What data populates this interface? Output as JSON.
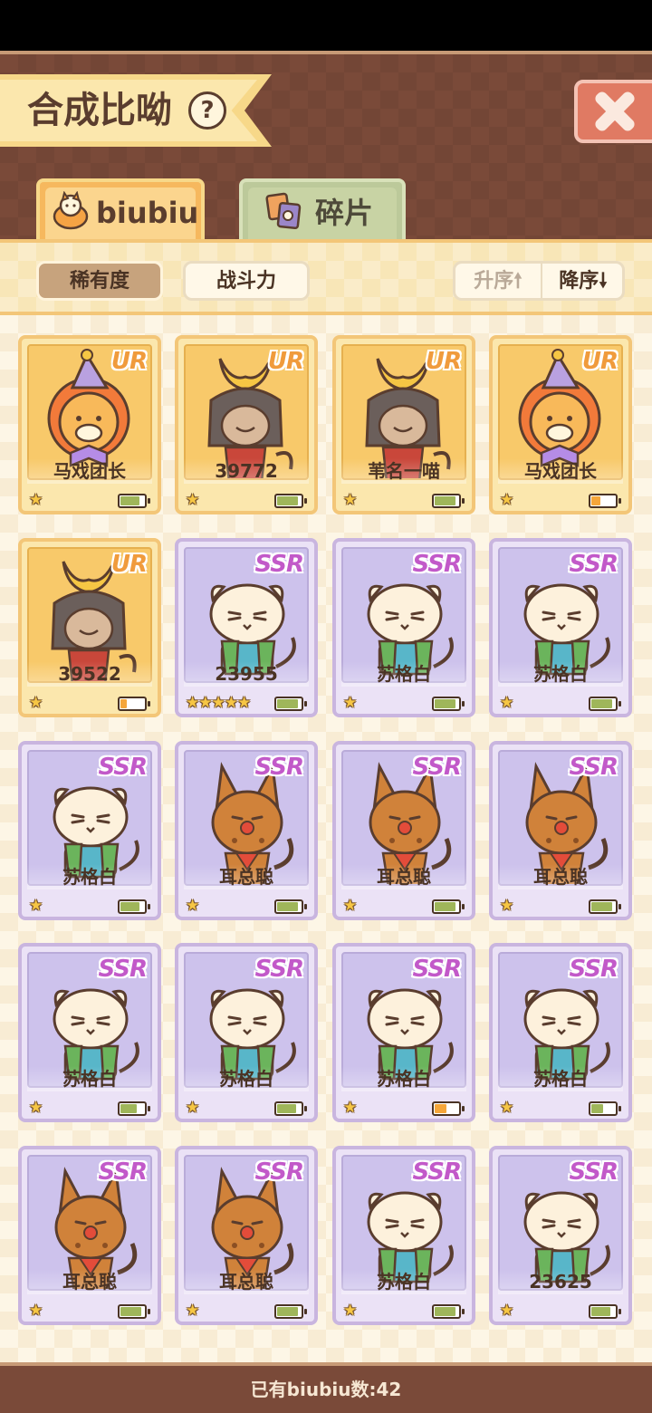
{
  "header": {
    "title": "合成比呦",
    "help_symbol": "?"
  },
  "tabs": [
    {
      "label": "biubiu",
      "active": true,
      "icon": "cat-head-icon"
    },
    {
      "label": "碎片",
      "active": false,
      "icon": "fragment-icon"
    }
  ],
  "sort": {
    "rarity_label": "稀有度",
    "power_label": "战斗力",
    "asc_label": "升序",
    "desc_label": "降序",
    "asc_arrow": "🠕",
    "desc_arrow": "🠗",
    "selected": "稀有度"
  },
  "colors": {
    "ur_badge": "#f09b3c",
    "ssr_badge": "#c259c9",
    "battery_full": "#9fb65a",
    "battery_low": "#f5a63a"
  },
  "cards": [
    {
      "rarity": "UR",
      "name": "马戏团长",
      "stars": "★",
      "battery": 0.8,
      "battery_color": "#9fb65a",
      "art": "clown-lion"
    },
    {
      "rarity": "UR",
      "name": "39772",
      "stars": "★",
      "battery": 0.9,
      "battery_color": "#9fb65a",
      "art": "samurai-cat"
    },
    {
      "rarity": "UR",
      "name": "苇名一喵",
      "stars": "★",
      "battery": 0.9,
      "battery_color": "#9fb65a",
      "art": "samurai-cat"
    },
    {
      "rarity": "UR",
      "name": "马戏团长",
      "stars": "★",
      "battery": 0.4,
      "battery_color": "#f5a63a",
      "art": "clown-lion"
    },
    {
      "rarity": "UR",
      "name": "39522",
      "stars": "★",
      "battery": 0.25,
      "battery_color": "#f5a63a",
      "art": "samurai-cat"
    },
    {
      "rarity": "SSR",
      "name": "23955",
      "stars": "★★★★★",
      "battery": 0.9,
      "battery_color": "#9fb65a",
      "art": "white-cat"
    },
    {
      "rarity": "SSR",
      "name": "苏格白",
      "stars": "★",
      "battery": 0.9,
      "battery_color": "#9fb65a",
      "art": "white-cat"
    },
    {
      "rarity": "SSR",
      "name": "苏格白",
      "stars": "★",
      "battery": 0.9,
      "battery_color": "#9fb65a",
      "art": "white-cat"
    },
    {
      "rarity": "SSR",
      "name": "苏格白",
      "stars": "★",
      "battery": 0.8,
      "battery_color": "#9fb65a",
      "art": "white-cat"
    },
    {
      "rarity": "SSR",
      "name": "耳总聪",
      "stars": "★",
      "battery": 0.9,
      "battery_color": "#9fb65a",
      "art": "caracal"
    },
    {
      "rarity": "SSR",
      "name": "耳总聪",
      "stars": "★",
      "battery": 0.9,
      "battery_color": "#9fb65a",
      "art": "caracal"
    },
    {
      "rarity": "SSR",
      "name": "耳总聪",
      "stars": "★",
      "battery": 0.9,
      "battery_color": "#9fb65a",
      "art": "caracal"
    },
    {
      "rarity": "SSR",
      "name": "苏格白",
      "stars": "★",
      "battery": 0.7,
      "battery_color": "#9fb65a",
      "art": "white-cat"
    },
    {
      "rarity": "SSR",
      "name": "苏格白",
      "stars": "★",
      "battery": 0.8,
      "battery_color": "#9fb65a",
      "art": "white-cat"
    },
    {
      "rarity": "SSR",
      "name": "苏格白",
      "stars": "★",
      "battery": 0.5,
      "battery_color": "#f5a63a",
      "art": "white-cat"
    },
    {
      "rarity": "SSR",
      "name": "苏格白",
      "stars": "★",
      "battery": 0.5,
      "battery_color": "#9fb65a",
      "art": "white-cat"
    },
    {
      "rarity": "SSR",
      "name": "耳总聪",
      "stars": "★",
      "battery": 0.9,
      "battery_color": "#9fb65a",
      "art": "caracal"
    },
    {
      "rarity": "SSR",
      "name": "耳总聪",
      "stars": "★",
      "battery": 0.9,
      "battery_color": "#9fb65a",
      "art": "caracal"
    },
    {
      "rarity": "SSR",
      "name": "苏格白",
      "stars": "★",
      "battery": 0.9,
      "battery_color": "#9fb65a",
      "art": "white-cat"
    },
    {
      "rarity": "SSR",
      "name": "23625",
      "stars": "★",
      "battery": 0.8,
      "battery_color": "#9fb65a",
      "art": "white-cat"
    }
  ],
  "footer": {
    "count_text": "已有biubiu数:42"
  }
}
